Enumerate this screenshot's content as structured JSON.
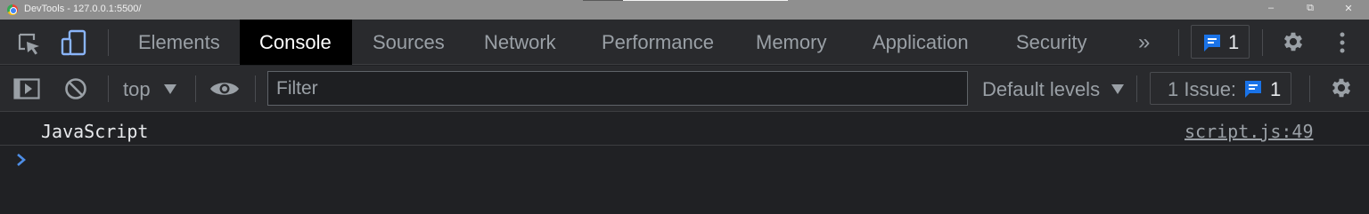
{
  "window": {
    "title": "DevTools - 127.0.0.1:5500/",
    "minimize": "–",
    "restore": "⧉",
    "close": "✕"
  },
  "tabs": [
    {
      "label": "Elements",
      "active": false
    },
    {
      "label": "Console",
      "active": true
    },
    {
      "label": "Sources",
      "active": false
    },
    {
      "label": "Network",
      "active": false
    },
    {
      "label": "Performance",
      "active": false
    },
    {
      "label": "Memory",
      "active": false
    },
    {
      "label": "Application",
      "active": false
    },
    {
      "label": "Security",
      "active": false
    }
  ],
  "more_tabs": "»",
  "top_issue_count": "1",
  "console_toolbar": {
    "context": "top",
    "filter_placeholder": "Filter",
    "levels": "Default levels",
    "issues_label": "1 Issue:",
    "issues_count": "1"
  },
  "messages": [
    {
      "text": "JavaScript",
      "source": "script.js:49"
    }
  ],
  "prompt": "›",
  "colors": {
    "accent": "#1a73e8",
    "prompt": "#4e8ee6",
    "active_tab_bg": "#000000"
  }
}
